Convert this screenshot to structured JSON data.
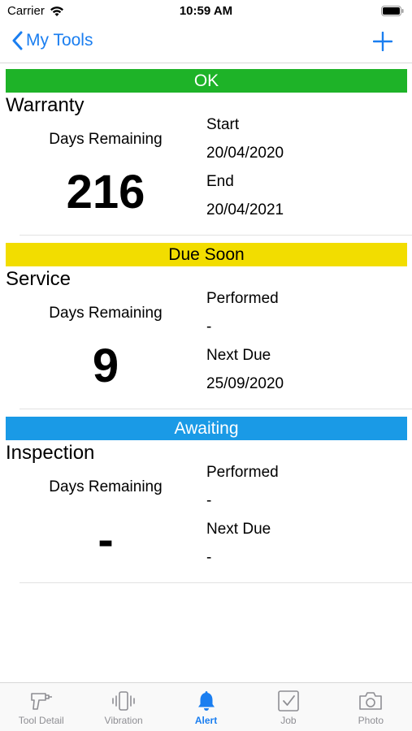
{
  "status_bar": {
    "carrier": "Carrier",
    "time": "10:59 AM"
  },
  "nav": {
    "back_label": "My Tools",
    "add_label": "+"
  },
  "sections": [
    {
      "banner": "OK",
      "banner_color": "#1eb328",
      "title": "Warranty",
      "days_label": "Days Remaining",
      "days_value": "216",
      "field1_label": "Start",
      "field1_value": "20/04/2020",
      "field2_label": "End",
      "field2_value": "20/04/2021"
    },
    {
      "banner": "Due Soon",
      "banner_color": "#f2dd00",
      "title": "Service",
      "days_label": "Days Remaining",
      "days_value": "9",
      "field1_label": "Performed",
      "field1_value": "-",
      "field2_label": "Next Due",
      "field2_value": "25/09/2020"
    },
    {
      "banner": "Awaiting",
      "banner_color": "#1a9ae6",
      "title": "Inspection",
      "days_label": "Days Remaining",
      "days_value": "-",
      "field1_label": "Performed",
      "field1_value": "-",
      "field2_label": "Next Due",
      "field2_value": "-"
    }
  ],
  "tabs": [
    {
      "label": "Tool Detail",
      "icon": "drill-icon"
    },
    {
      "label": "Vibration",
      "icon": "vibration-icon"
    },
    {
      "label": "Alert",
      "icon": "bell-icon",
      "active": true
    },
    {
      "label": "Job",
      "icon": "checkbox-icon"
    },
    {
      "label": "Photo",
      "icon": "camera-icon"
    }
  ],
  "colors": {
    "accent": "#1a7ef0",
    "inactive_tab": "#8e8e93"
  }
}
